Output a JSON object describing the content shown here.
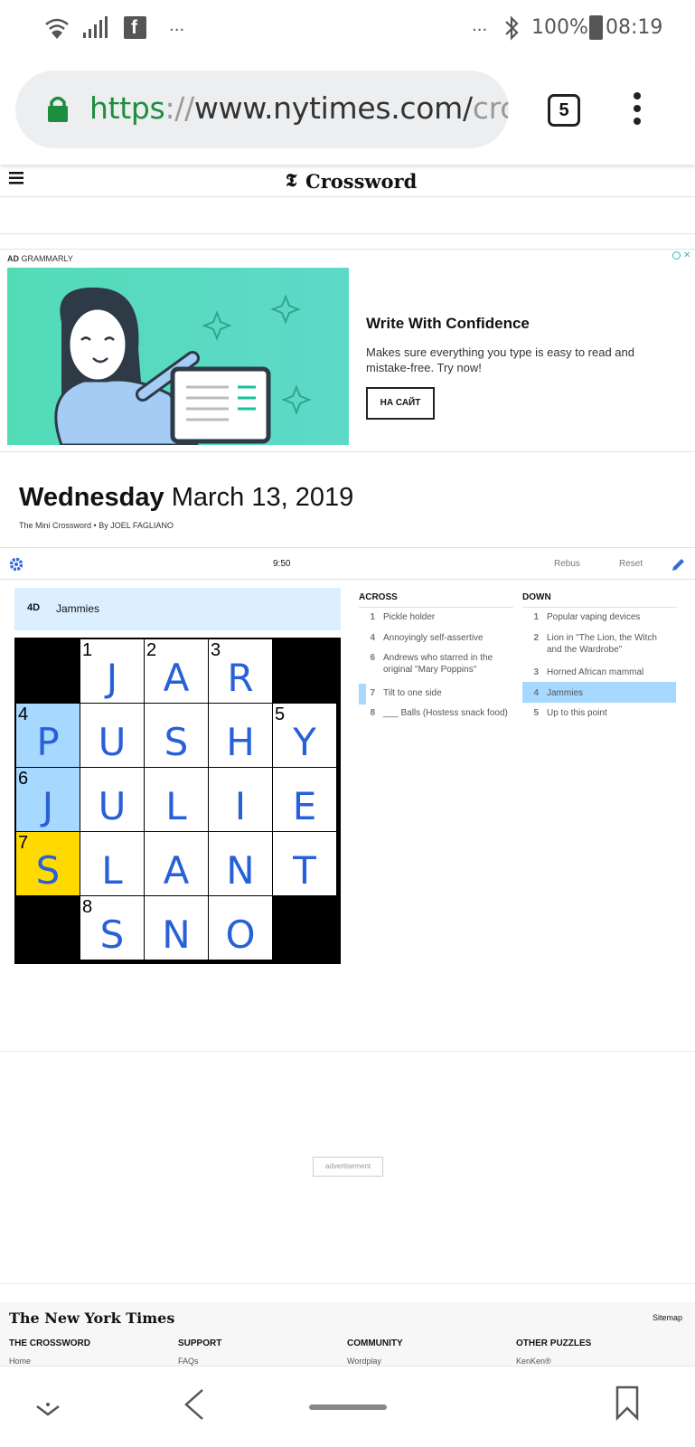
{
  "status_bar": {
    "battery": "100%",
    "time": "08:19",
    "dots_left": "...",
    "dots_right": "..."
  },
  "browser": {
    "url_https": "https",
    "url_sep": "://",
    "url_domain": "www.nytimes.com/",
    "url_fade": "crc",
    "tab_count": "5"
  },
  "header": {
    "brand": "Crossword"
  },
  "ad": {
    "label": "AD",
    "sponsor": "GRAMMARLY",
    "title": "Write With Confidence",
    "body": "Makes sure everything you type is easy to read and mistake-free. Try now!",
    "button": "НА САЙТ"
  },
  "puzzle": {
    "weekday": "Wednesday",
    "date": "March 13, 2019",
    "name": "The Mini Crossword",
    "byline": "By JOEL FAGLIANO",
    "separator": "•",
    "timer": "9:50",
    "rebus": "Rebus",
    "reset": "Reset",
    "active_clue_num": "4D",
    "active_clue_text": "Jammies"
  },
  "grid": [
    [
      "#",
      {
        "n": "1",
        "l": "J"
      },
      {
        "n": "2",
        "l": "A"
      },
      {
        "n": "3",
        "l": "R"
      },
      "#"
    ],
    [
      {
        "n": "4",
        "l": "P"
      },
      {
        "n": "",
        "l": "U"
      },
      {
        "n": "",
        "l": "S"
      },
      {
        "n": "",
        "l": "H"
      },
      {
        "n": "5",
        "l": "Y"
      }
    ],
    [
      {
        "n": "6",
        "l": "J"
      },
      {
        "n": "",
        "l": "U"
      },
      {
        "n": "",
        "l": "L"
      },
      {
        "n": "",
        "l": "I"
      },
      {
        "n": "",
        "l": "E"
      }
    ],
    [
      {
        "n": "7",
        "l": "S"
      },
      {
        "n": "",
        "l": "L"
      },
      {
        "n": "",
        "l": "A"
      },
      {
        "n": "",
        "l": "N"
      },
      {
        "n": "",
        "l": "T"
      }
    ],
    [
      "#",
      {
        "n": "8",
        "l": "S"
      },
      {
        "n": "",
        "l": "N"
      },
      {
        "n": "",
        "l": "O"
      },
      "#"
    ]
  ],
  "highlight_cells": {
    "selected": [
      3,
      0
    ],
    "word": [
      [
        1,
        0
      ],
      [
        2,
        0
      ],
      [
        3,
        0
      ]
    ]
  },
  "colors": {
    "selected": "#ffda00",
    "word": "#a7d8ff",
    "letters": "#2860d8",
    "active_clue": "#a7d8ff"
  },
  "across": {
    "heading": "ACROSS",
    "clues": [
      {
        "n": "1",
        "t": "Pickle holder"
      },
      {
        "n": "4",
        "t": "Annoyingly self-assertive"
      },
      {
        "n": "6",
        "t": "Andrews who starred in the original \"Mary Poppins\""
      },
      {
        "n": "7",
        "t": "Tilt to one side"
      },
      {
        "n": "8",
        "t": "___ Balls (Hostess snack food)"
      }
    ]
  },
  "down": {
    "heading": "DOWN",
    "clues": [
      {
        "n": "1",
        "t": "Popular vaping devices"
      },
      {
        "n": "2",
        "t": "Lion in \"The Lion, the Witch and the Wardrobe\""
      },
      {
        "n": "3",
        "t": "Horned African mammal"
      },
      {
        "n": "4",
        "t": "Jammies"
      },
      {
        "n": "5",
        "t": "Up to this point"
      }
    ]
  },
  "big_ad": {
    "label": "advertisement"
  },
  "footer": {
    "logo": "The New York Times",
    "sitemap": "Sitemap",
    "columns": [
      {
        "title": "THE CROSSWORD",
        "sub": "Home"
      },
      {
        "title": "SUPPORT",
        "sub": "FAQs"
      },
      {
        "title": "COMMUNITY",
        "sub": "Wordplay"
      },
      {
        "title": "OTHER PUZZLES",
        "sub": "KenKen®"
      }
    ]
  }
}
